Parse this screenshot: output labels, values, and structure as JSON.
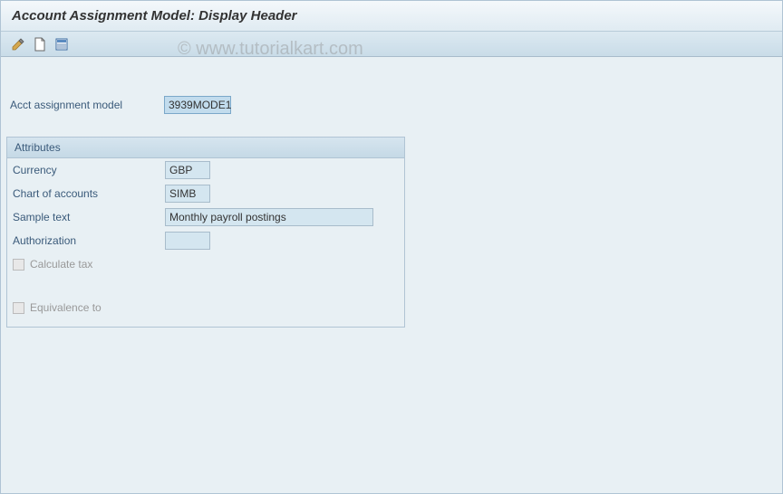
{
  "header": {
    "title": "Account Assignment Model: Display Header"
  },
  "toolbar": {
    "icon1": "change-icon",
    "icon2": "document-icon",
    "icon3": "overview-icon"
  },
  "main": {
    "model_label": "Acct assignment model",
    "model_value": "3939MODE1"
  },
  "attributes": {
    "group_title": "Attributes",
    "currency_label": "Currency",
    "currency_value": "GBP",
    "chart_label": "Chart of accounts",
    "chart_value": "SIMB",
    "sample_label": "Sample text",
    "sample_value": "Monthly payroll postings",
    "auth_label": "Authorization",
    "auth_value": "",
    "calc_tax_label": "Calculate tax",
    "equiv_label": "Equivalence to"
  },
  "watermark": "© www.tutorialkart.com"
}
